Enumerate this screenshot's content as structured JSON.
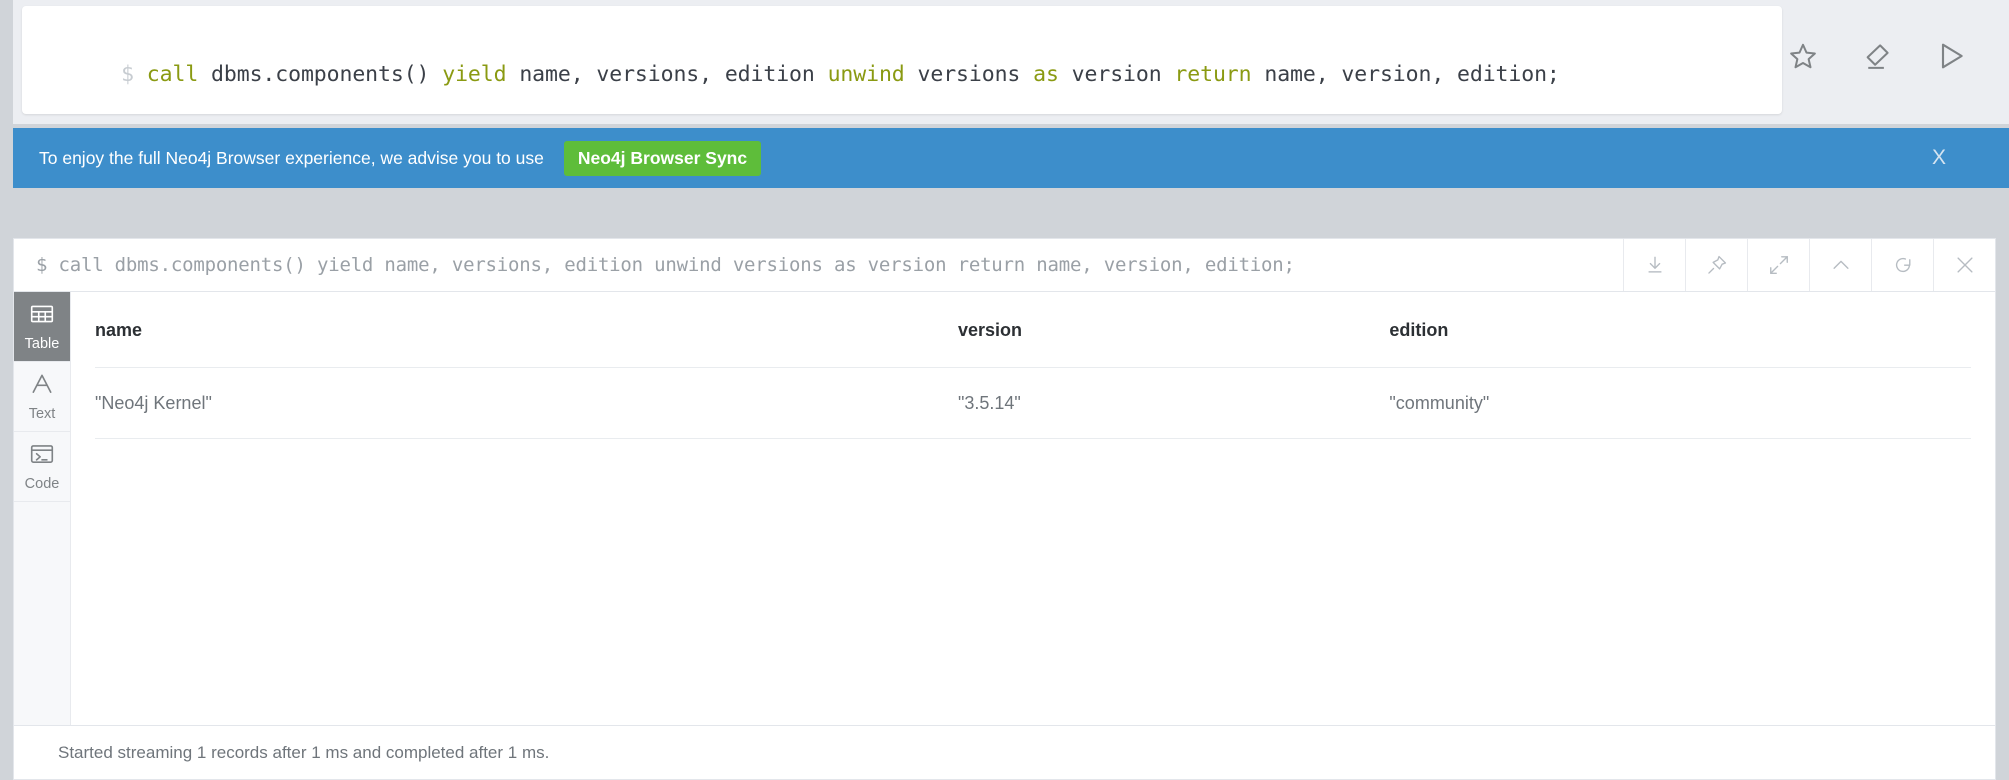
{
  "editor": {
    "prompt": "$",
    "query_tokens": [
      {
        "t": "call",
        "k": true
      },
      {
        "t": " dbms.components() ",
        "k": false
      },
      {
        "t": "yield",
        "k": true
      },
      {
        "t": " name, versions, edition ",
        "k": false
      },
      {
        "t": "unwind",
        "k": true
      },
      {
        "t": " versions ",
        "k": false
      },
      {
        "t": "as",
        "k": true
      },
      {
        "t": " version ",
        "k": false
      },
      {
        "t": "return",
        "k": true
      },
      {
        "t": " name, version, edition;",
        "k": false
      }
    ],
    "actions": [
      {
        "name": "favorite-icon",
        "label": "Favorite"
      },
      {
        "name": "clear-icon",
        "label": "Clear"
      },
      {
        "name": "run-icon",
        "label": "Run"
      }
    ],
    "keyword_color": "#8a9a12",
    "text_color": "#3b4048"
  },
  "banner": {
    "message": "To enjoy the full Neo4j Browser experience, we advise you to use",
    "button_label": "Neo4j Browser Sync",
    "close_label": "X",
    "background": "#3d8ecb",
    "button_color": "#5ebd3a"
  },
  "frame": {
    "query": "$ call dbms.components() yield name, versions, edition unwind versions as version return name, version, edition;",
    "tools": [
      {
        "name": "download-icon",
        "label": "Download"
      },
      {
        "name": "pin-icon",
        "label": "Pin"
      },
      {
        "name": "expand-icon",
        "label": "Expand"
      },
      {
        "name": "collapse-icon",
        "label": "Collapse"
      },
      {
        "name": "refresh-icon",
        "label": "Refresh"
      },
      {
        "name": "close-icon",
        "label": "Close"
      }
    ],
    "view_tabs": [
      {
        "name": "tab-table",
        "label": "Table",
        "icon": "table-icon",
        "active": true
      },
      {
        "name": "tab-text",
        "label": "Text",
        "icon": "text-icon",
        "active": false
      },
      {
        "name": "tab-code",
        "label": "Code",
        "icon": "code-icon",
        "active": false
      }
    ],
    "table": {
      "columns": [
        "name",
        "version",
        "edition"
      ],
      "rows": [
        [
          "\"Neo4j Kernel\"",
          "\"3.5.14\"",
          "\"community\""
        ]
      ]
    },
    "status": "Started streaming 1 records after 1 ms and completed after 1 ms."
  }
}
